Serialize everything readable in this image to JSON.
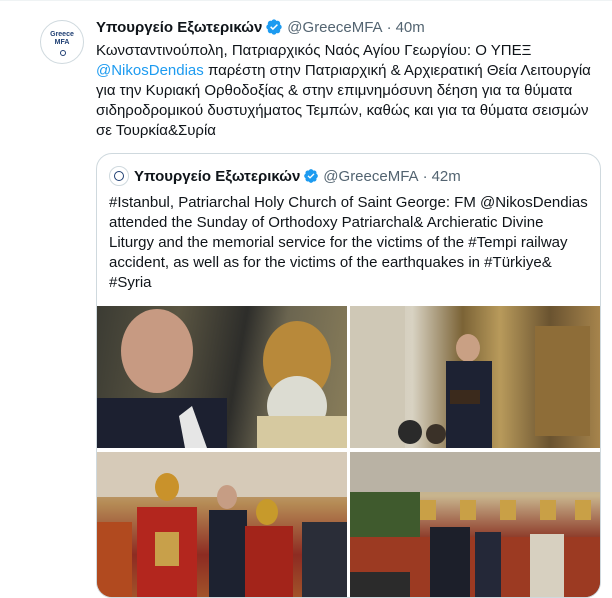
{
  "tweet": {
    "avatar_text_line1": "Greece",
    "avatar_text_line2": "MFA",
    "name": "Υπουργείο Εξωτερικών",
    "handle": "@GreeceMFA",
    "separator": "·",
    "time": "40m",
    "text_before_mention": "Κωνσταντινούπολη, Πατριαρχικός Ναός Αγίου Γεωργίου: Ο ΥΠΕΞ",
    "mention": "@NikosDendias",
    "text_after_mention": " παρέστη στην Πατριαρχική & Αρχιερατική Θεία Λειτουργία για την Κυριακή Ορθοδοξίας & στην επιμνημόσυνη δέηση για τα θύματα  σιδηροδρομικού δυστυχήματος Τεμπών, καθώς και για τα θύματα σεισμών σε Τουρκία&Συρία"
  },
  "quoted": {
    "name": "Υπουργείο Εξωτερικών",
    "handle": "@GreeceMFA",
    "separator": "·",
    "time": "42m",
    "text": "#Istanbul, Patriarchal Holy Church of Saint George: FM @NikosDendias attended the Sunday of Orthodoxy Patriarchal& Archieratic Divine Liturgy and the memorial service for the victims of the #Tempi railway accident, as well as for the victims of the earthquakes in #Türkiye& #Syria"
  },
  "colors": {
    "link": "#1d9bf0",
    "verified": "#1d9bf0",
    "secondary_text": "#536471",
    "border": "#cfd9de"
  },
  "icons": {
    "verified": "verified-badge-icon"
  }
}
